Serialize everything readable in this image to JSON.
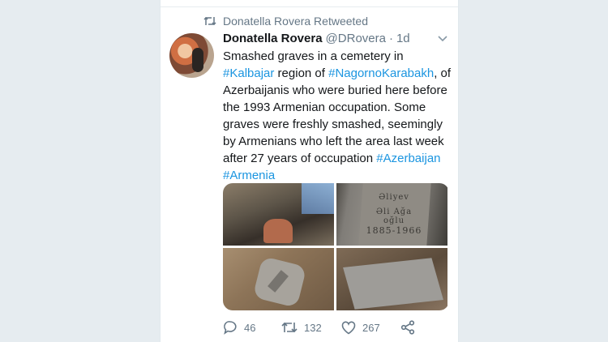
{
  "retweet_notice": "Donatella Rovera Retweeted",
  "tweet": {
    "name": "Donatella Rovera",
    "handle": "@DRovera",
    "separator": "·",
    "time": "1d",
    "text_parts": [
      {
        "text": "Smashed graves in a cemetery in ",
        "link": false
      },
      {
        "text": "#Kalbajar",
        "link": true
      },
      {
        "text": " region of ",
        "link": false
      },
      {
        "text": "#NagornoKarabakh",
        "link": true
      },
      {
        "text": ", of Azerbaijanis who were buried here before the 1993 Armenian occupation. Some graves were freshly smashed, seemingly by Armenians who left the area last week after 27 years of occupation ",
        "link": false
      },
      {
        "text": "#Azerbaijan",
        "link": true
      },
      {
        "text": " ",
        "link": false
      },
      {
        "text": "#Armenia",
        "link": true
      }
    ],
    "photo_text": [
      "Əliyev",
      "Əli Ağa oğlu",
      "1885-1966"
    ],
    "replies": "46",
    "retweets": "132",
    "likes": "267"
  },
  "colors": {
    "link": "#1b95e0",
    "secondary": "#657786",
    "background": "#e6ecf0"
  },
  "icons": [
    "retweet-icon",
    "chevron-down-icon",
    "reply-icon",
    "like-icon",
    "share-icon"
  ]
}
